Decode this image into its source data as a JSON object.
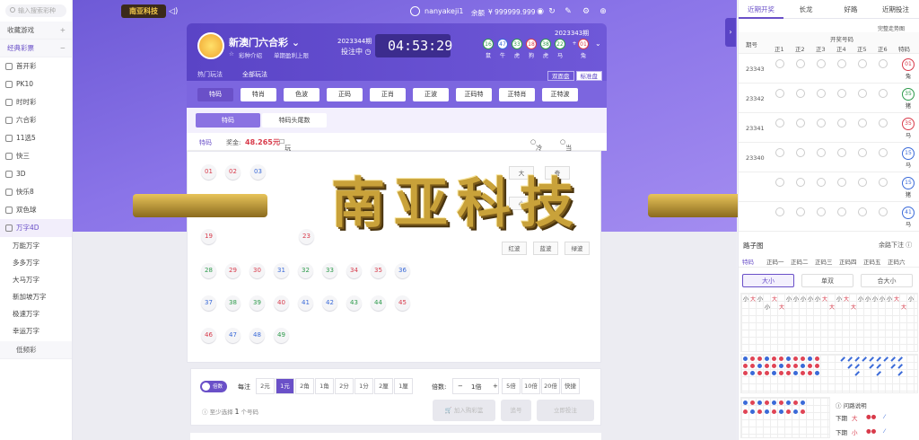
{
  "sidebar": {
    "search_placeholder": "输入搜索彩种",
    "groups": [
      {
        "label": "收藏游戏",
        "sign": "+"
      },
      {
        "label": "经典彩票",
        "sign": "−"
      }
    ],
    "items": [
      "首开彩",
      "PK10",
      "时时彩",
      "六合彩",
      "11选5",
      "快三",
      "3D",
      "快乐8",
      "双色球",
      "万字4D"
    ],
    "subitems": [
      "万能万字",
      "多多万字",
      "大马万字",
      "新加坡万字",
      "极速万字",
      "幸运万字"
    ],
    "footer": "低频彩"
  },
  "topbar": {
    "logo": "南亚科技",
    "username": "nanyakeji1",
    "balance_label": "余额",
    "balance": "¥ 999999.999"
  },
  "game": {
    "name": "新澳门六合彩",
    "intro": "彩种介绍",
    "limit": "单期盈利上限",
    "current_period": "2023344期",
    "bet_status": "投注中",
    "countdown": "04:53:29",
    "prev_period": "2023343期",
    "result_balls": [
      {
        "n": "16",
        "z": "鼠",
        "c": "green"
      },
      {
        "n": "47",
        "z": "牛",
        "c": "blue"
      },
      {
        "n": "33",
        "z": "虎",
        "c": "green"
      },
      {
        "n": "18",
        "z": "狗",
        "c": "red"
      },
      {
        "n": "38",
        "z": "虎",
        "c": "green"
      },
      {
        "n": "22",
        "z": "马",
        "c": "green"
      },
      {
        "n": "01",
        "z": "兔",
        "c": "red"
      }
    ],
    "result_plus": "+"
  },
  "play_tabs": [
    "热门玩法",
    "全部玩法"
  ],
  "disk_tabs": [
    "双面盘",
    "标准盘"
  ],
  "categories": [
    "特码",
    "特肖",
    "色波",
    "正码",
    "正肖",
    "正波",
    "正码特",
    "正特肖",
    "正特波"
  ],
  "sub_tabs": [
    "特码",
    "特码头尾数"
  ],
  "odds": {
    "label": "特码",
    "prize_label": "奖金:",
    "prize": "48.265元",
    "rule": "玩法说明",
    "opt1": "冷热",
    "opt2": "当前遗漏"
  },
  "numbers": [
    {
      "n": "01",
      "c": "red"
    },
    {
      "n": "02",
      "c": "red"
    },
    {
      "n": "03",
      "c": "blue"
    },
    {
      "n": "12",
      "c": "red"
    },
    {
      "n": "19",
      "c": "red"
    },
    {
      "n": "23",
      "c": "red"
    },
    {
      "n": "28",
      "c": "green"
    },
    {
      "n": "29",
      "c": "red"
    },
    {
      "n": "30",
      "c": "red"
    },
    {
      "n": "31",
      "c": "blue"
    },
    {
      "n": "32",
      "c": "green"
    },
    {
      "n": "33",
      "c": "green"
    },
    {
      "n": "34",
      "c": "red"
    },
    {
      "n": "35",
      "c": "red"
    },
    {
      "n": "36",
      "c": "blue"
    },
    {
      "n": "37",
      "c": "blue"
    },
    {
      "n": "38",
      "c": "green"
    },
    {
      "n": "39",
      "c": "green"
    },
    {
      "n": "40",
      "c": "red"
    },
    {
      "n": "41",
      "c": "blue"
    },
    {
      "n": "42",
      "c": "blue"
    },
    {
      "n": "43",
      "c": "green"
    },
    {
      "n": "44",
      "c": "green"
    },
    {
      "n": "45",
      "c": "red"
    },
    {
      "n": "46",
      "c": "red"
    },
    {
      "n": "47",
      "c": "blue"
    },
    {
      "n": "48",
      "c": "blue"
    },
    {
      "n": "49",
      "c": "green"
    }
  ],
  "attr_buttons": [
    "大",
    "奇",
    "小",
    "偶",
    "红波",
    "蓝波",
    "绿波"
  ],
  "watermark": "南亚科技",
  "stake": {
    "toggle": "倍数",
    "unit_label": "每注",
    "units": [
      "2元",
      "1元",
      "2角",
      "1角",
      "2分",
      "1分",
      "2厘",
      "1厘"
    ],
    "active_unit": "1元",
    "mult_label": "倍数:",
    "mult_minus": "−",
    "mult_value": "1倍",
    "mult_plus": "+",
    "mults": [
      "5倍",
      "10倍",
      "20倍",
      "快捷"
    ],
    "min_sel_prefix": "至少选择",
    "min_sel_count": "1",
    "min_sel_suffix": "个号码",
    "add_cart": "加入购彩篮",
    "chase": "追号",
    "bet_now": "立即投注"
  },
  "right": {
    "tabs": [
      "近期开奖",
      "长龙",
      "好路",
      "近期投注"
    ],
    "more": "完整走势图",
    "col_period": "期号",
    "col_group": "开奖号码",
    "cols": [
      "正1",
      "正2",
      "正3",
      "正4",
      "正5",
      "正6",
      "特码"
    ],
    "history": [
      {
        "p": "23343",
        "sp": "01",
        "z": "兔",
        "c": "red"
      },
      {
        "p": "23342",
        "sp": "35",
        "z": "猪",
        "c": "green"
      },
      {
        "p": "23341",
        "sp": "35",
        "z": "马",
        "c": "red"
      },
      {
        "p": "23340",
        "sp": "15",
        "z": "马",
        "c": "blue"
      },
      {
        "p": "",
        "sp": "15",
        "z": "猪",
        "c": "blue"
      },
      {
        "p": "",
        "sp": "41",
        "z": "马",
        "c": "blue"
      }
    ],
    "road_title": "路子图",
    "road_more": "余路下注",
    "road_tabs": [
      "特码",
      "正码一",
      "正码二",
      "正码三",
      "正码四",
      "正码五",
      "正码六"
    ],
    "road_btns": [
      "大小",
      "单双",
      "合大小"
    ],
    "road_big": "大",
    "road_small": "小",
    "ask_way": "问路说明",
    "ask_rows": [
      {
        "label": "下期",
        "v": "大"
      },
      {
        "label": "下期",
        "v": "小"
      }
    ]
  }
}
